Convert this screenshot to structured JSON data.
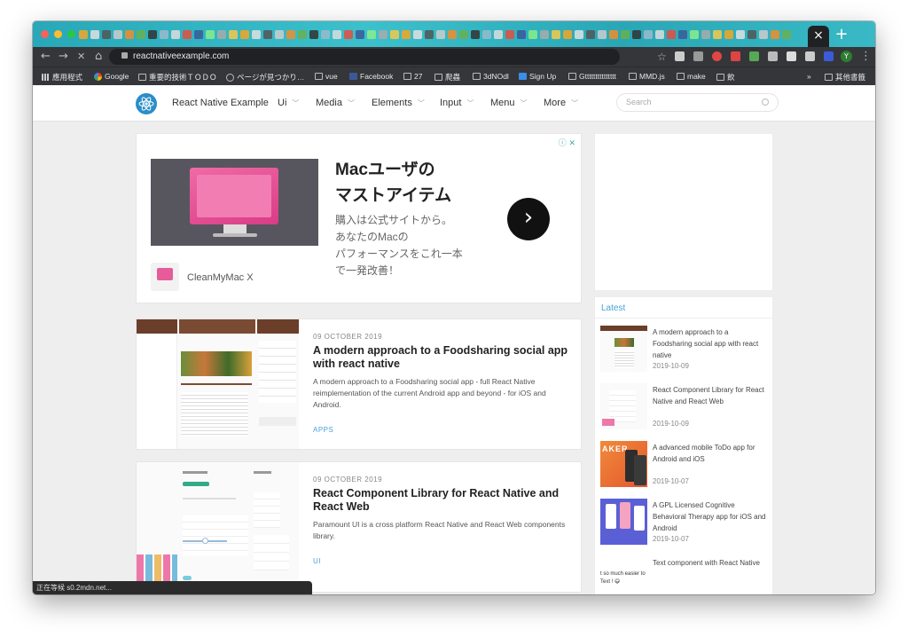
{
  "window": {
    "traffic_colors": [
      "#ff5f57",
      "#ffbd2e",
      "#28c840"
    ],
    "close_tab": "×",
    "new_tab": "+"
  },
  "toolbar": {
    "back": "←",
    "forward": "→",
    "stop": "✕",
    "home": "⌂",
    "url": "reactnativeexample.com",
    "star": "☆",
    "profile": "Y",
    "more": "⋮"
  },
  "bookmarks": {
    "items": [
      {
        "label": "應用程式",
        "icon": "apps-grid-icon"
      },
      {
        "label": "Google",
        "icon": "google-icon"
      },
      {
        "label": "重要的技術ＴＯＤＯ",
        "icon": "folder-icon"
      },
      {
        "label": "ページが見つかり…",
        "icon": "globe-icon"
      },
      {
        "label": "vue",
        "icon": "folder-icon"
      },
      {
        "label": "Facebook",
        "icon": "facebook-icon"
      },
      {
        "label": "27",
        "icon": "folder-icon"
      },
      {
        "label": "爬蟲",
        "icon": "folder-icon"
      },
      {
        "label": "3dNOdl",
        "icon": "folder-icon"
      },
      {
        "label": "Sign Up",
        "icon": "signup-icon"
      },
      {
        "label": "Gttttttttttttttt",
        "icon": "folder-icon"
      },
      {
        "label": "MMD.js",
        "icon": "folder-icon"
      },
      {
        "label": "make",
        "icon": "folder-icon"
      },
      {
        "label": "飲",
        "icon": "folder-icon"
      }
    ],
    "overflow": "»",
    "other": "其他書籤"
  },
  "site": {
    "brand": "React Native Example",
    "menu": [
      "Ui",
      "Media",
      "Elements",
      "Input",
      "Menu",
      "More"
    ],
    "search_placeholder": "Search",
    "accent": "#4aa3d8"
  },
  "ad": {
    "heading_line1": "Macユーザの",
    "heading_line2": "マストアイテム",
    "text_lines": [
      "購入は公式サイトから。",
      "あなたのMacの",
      "パフォーマンスをこれ一本",
      "で一発改善！"
    ],
    "advertiser": "CleanMyMac X",
    "next": "›",
    "info": "ⓘ ✕"
  },
  "cards": [
    {
      "date": "09 OCTOBER 2019",
      "title": "A modern approach to a Foodsharing social app with react native",
      "desc": "A modern approach to a Foodsharing social app - full React Native reimplementation of the current Android app and beyond - for iOS and Android.",
      "tag": "APPS"
    },
    {
      "date": "09 OCTOBER 2019",
      "title": "React Component Library for React Native and React Web",
      "desc": "Paramount UI is a cross platform React Native and React Web components library.",
      "tag": "UI"
    }
  ],
  "sidebar": {
    "title": "Latest",
    "items": [
      {
        "title": "A modern approach to a Foodsharing social app with react native",
        "date": "2019-10-09"
      },
      {
        "title": "React Component Library for React Native and React Web",
        "date": "2019-10-09"
      },
      {
        "title": "A advanced mobile ToDo app for Android and iOS",
        "date": "2019-10-07",
        "thumb_text": "AKER"
      },
      {
        "title": "A GPL Licensed Cognitive Behavioral Therapy app for iOS and Android",
        "date": "2019-10-07"
      },
      {
        "title": "Text component with React Native",
        "date": "",
        "thumb_text": "t so much easier to Text ! 😄"
      }
    ]
  },
  "status_bar": "正在等候 s0.2mdn.net..."
}
